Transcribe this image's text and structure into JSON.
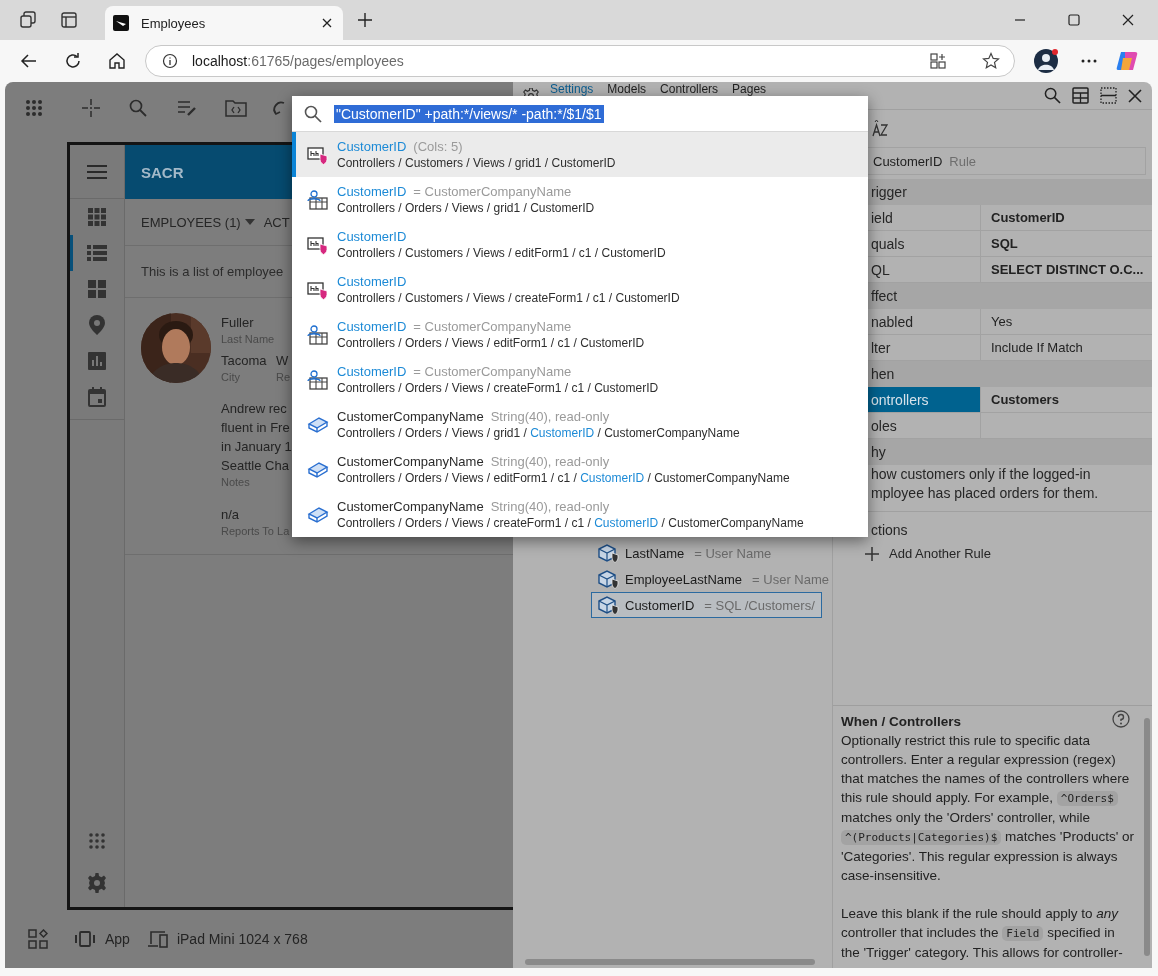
{
  "browser": {
    "tab_title": "Employees",
    "url_host": "localhost",
    "url_path": ":61765/pages/employees"
  },
  "app": {
    "title": "SACR",
    "view_menu": "EMPLOYEES (1)",
    "actions_menu": "ACT",
    "description": "This is a list of employee",
    "nav_items": [
      {
        "kind": "apps",
        "selected": false
      },
      {
        "kind": "list",
        "selected": true
      },
      {
        "kind": "dashboard",
        "selected": false
      },
      {
        "kind": "pin",
        "selected": false
      },
      {
        "kind": "chart",
        "selected": false
      },
      {
        "kind": "calendar",
        "selected": false
      }
    ],
    "card": {
      "last_name": {
        "value": "Fuller",
        "label": "Last Name"
      },
      "city": {
        "value": "Tacoma",
        "label": "City"
      },
      "region": {
        "value": "W",
        "label": "Re"
      },
      "notes": {
        "lines": [
          "Andrew rec",
          "fluent in Fre",
          "in January 1",
          "Seattle Cha"
        ],
        "label": "Notes"
      },
      "reports_to": {
        "value": "n/a",
        "label": "Reports To La"
      }
    }
  },
  "bottom_bar": {
    "mode": "App",
    "device": "iPad Mini 1024 x 768"
  },
  "designer": {
    "tabs": [
      {
        "label": "Settings",
        "selected": true
      },
      {
        "label": "Models",
        "selected": false
      },
      {
        "label": "Controllers",
        "selected": false
      },
      {
        "label": "Pages",
        "selected": false
      }
    ],
    "tree": [
      {
        "name": "LastName",
        "note": "= User Name",
        "selected": false
      },
      {
        "name": "EmployeeLastName",
        "note": "= User Name",
        "selected": false
      },
      {
        "name": "CustomerID",
        "note": "= SQL /Customers/",
        "selected": true
      }
    ],
    "properties": {
      "title": "CustomerID",
      "title_note": "Rule",
      "rows": [
        {
          "kind": "category",
          "label": "rigger"
        },
        {
          "kind": "property",
          "label": "ield",
          "value": "CustomerID",
          "modified": true,
          "selected": false
        },
        {
          "kind": "property",
          "label": "quals",
          "value": "SQL",
          "modified": true,
          "selected": false
        },
        {
          "kind": "property",
          "label": "QL",
          "value": "SELECT DISTINCT O.C...",
          "modified": true,
          "selected": false
        },
        {
          "kind": "category",
          "label": "ffect"
        },
        {
          "kind": "property",
          "label": "nabled",
          "value": "Yes",
          "modified": false,
          "selected": false
        },
        {
          "kind": "property",
          "label": "lter",
          "value": "Include If Match",
          "modified": false,
          "selected": false
        },
        {
          "kind": "category",
          "label": "hen"
        },
        {
          "kind": "property",
          "label": "ontrollers",
          "value": "Customers",
          "modified": true,
          "selected": true
        },
        {
          "kind": "property",
          "label": "oles",
          "selected": false
        },
        {
          "kind": "category",
          "label": "hy"
        },
        {
          "kind": "text",
          "label": "how customers only if the logged-in"
        },
        {
          "kind": "text",
          "label": "mployee has placed orders for them."
        },
        {
          "kind": "heading",
          "label": "ctions"
        },
        {
          "kind": "action",
          "label": "Add Another Rule"
        }
      ]
    },
    "help": {
      "title": "When / Controllers",
      "paragraphs": [
        [
          {
            "kind": "text",
            "text": "Optionally restrict this rule to specific data controllers. Enter a regular expression (regex) that matches the names of the controllers where this rule should apply. For example, "
          },
          {
            "kind": "code",
            "text": "^Orders$"
          },
          {
            "kind": "text",
            "text": " matches only the 'Orders' controller, while "
          },
          {
            "kind": "code",
            "text": "^(Products|Categories)$"
          },
          {
            "kind": "text",
            "text": " matches 'Products' or 'Categories'. This regular expression is always case-insensitive."
          }
        ],
        [
          {
            "kind": "text",
            "text": "Leave this blank if the rule should apply to *any* controller that includes the "
          },
          {
            "kind": "code",
            "text": "Field"
          },
          {
            "kind": "text",
            "text": " specified in the 'Trigger' category. This allows for controller-"
          }
        ]
      ]
    }
  },
  "search": {
    "query": "\"CustomerID\" +path:*/views/* -path:*/$1/$1",
    "query_selected": true,
    "results": [
      {
        "kind": "field",
        "name": "CustomerID",
        "name_match": true,
        "note": "(Cols: 5)",
        "path": "Controllers / Customers / Views / grid1 / CustomerID",
        "selected": true
      },
      {
        "kind": "lookup",
        "name": "CustomerID",
        "name_match": true,
        "note": "= CustomerCompanyName",
        "path": "Controllers / Orders / Views / grid1 / CustomerID",
        "selected": false
      },
      {
        "kind": "field",
        "name": "CustomerID",
        "name_match": true,
        "path": "Controllers / Customers / Views / editForm1 / c1 / CustomerID",
        "selected": false
      },
      {
        "kind": "field",
        "name": "CustomerID",
        "name_match": true,
        "path": "Controllers / Customers / Views / createForm1 / c1 / CustomerID",
        "selected": false
      },
      {
        "kind": "lookup",
        "name": "CustomerID",
        "name_match": true,
        "note": "= CustomerCompanyName",
        "path": "Controllers / Orders / Views / editForm1 / c1 / CustomerID",
        "selected": false
      },
      {
        "kind": "lookup",
        "name": "CustomerID",
        "name_match": true,
        "note": "= CustomerCompanyName",
        "path": "Controllers / Orders / Views / createForm1 / c1 / CustomerID",
        "selected": false
      },
      {
        "kind": "box",
        "name": "CustomerCompanyName",
        "name_match": false,
        "note": "String(40), read-only",
        "path": "Controllers / Orders / Views / grid1 / ",
        "path_match": "CustomerID",
        "path_end": " / CustomerCompanyName",
        "selected": false
      },
      {
        "kind": "box",
        "name": "CustomerCompanyName",
        "name_match": false,
        "note": "String(40), read-only",
        "path": "Controllers / Orders / Views / editForm1 / c1 / ",
        "path_match": "CustomerID",
        "path_end": " / CustomerCompanyName",
        "selected": false
      },
      {
        "kind": "box",
        "name": "CustomerCompanyName",
        "name_match": false,
        "note": "String(40), read-only",
        "path": "Controllers / Orders / Views / createForm1 / c1 / ",
        "path_match": "CustomerID",
        "path_end": " / CustomerCompanyName",
        "selected": false
      }
    ]
  }
}
